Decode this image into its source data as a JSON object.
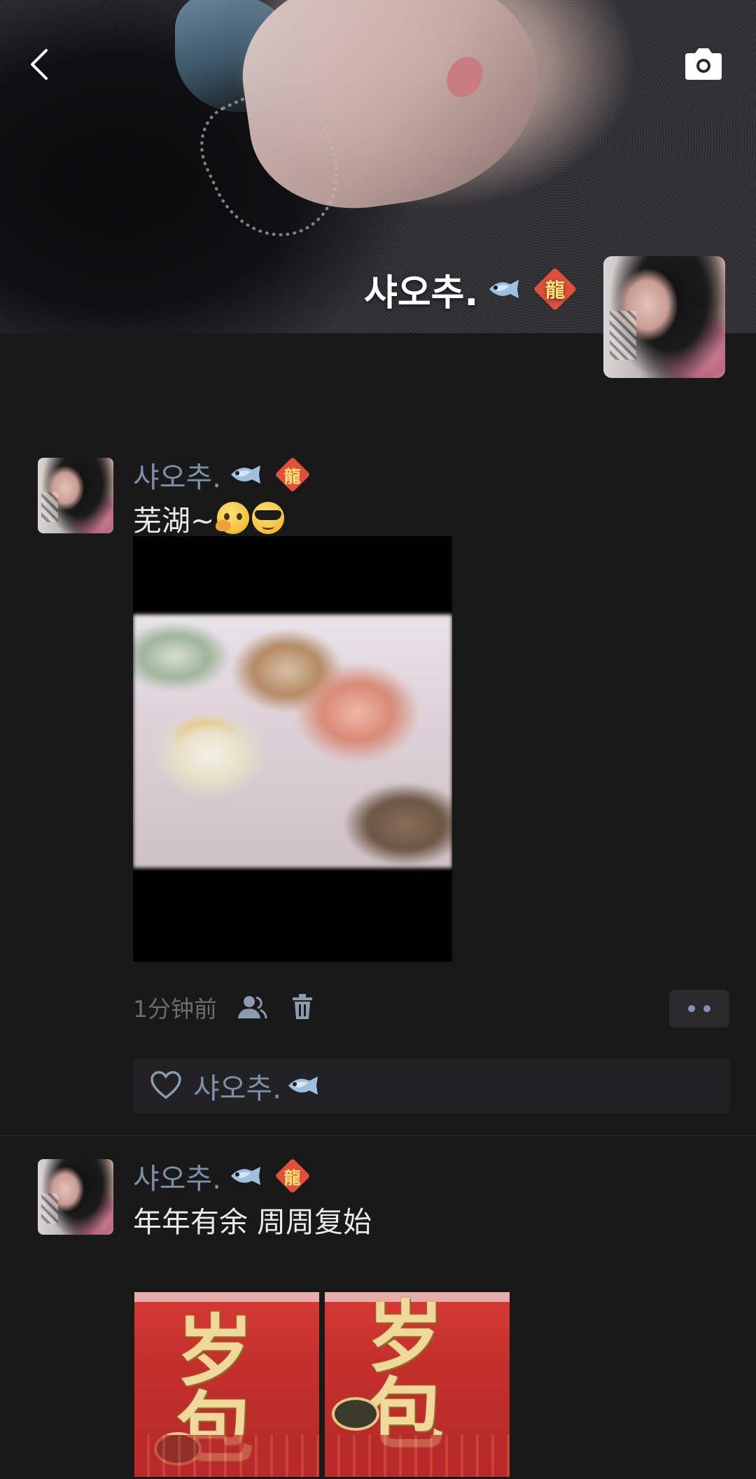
{
  "header": {
    "back_icon": "chevron-left-icon",
    "camera_icon": "camera-icon",
    "profile_name": "샤오추."
  },
  "posts": [
    {
      "author": "샤오추.",
      "text": "芜湖~",
      "emojis": [
        "thinking-face-emoji",
        "sunglasses-face-emoji"
      ],
      "media": "video",
      "time": "1分钟前",
      "likes": [
        "샤오추."
      ]
    },
    {
      "author": "샤오추.",
      "text": "年年有余 周周复始",
      "media": "images",
      "images": [
        {
          "caption": "岁包"
        },
        {
          "caption": "岁包"
        }
      ]
    }
  ],
  "colors": {
    "background": "#191919",
    "name_blue": "#7d90a9",
    "text": "#e9e9e9",
    "meta_gray": "#6c6c6c",
    "likes_bg": "#222224",
    "badge_red": "#e0503a"
  }
}
